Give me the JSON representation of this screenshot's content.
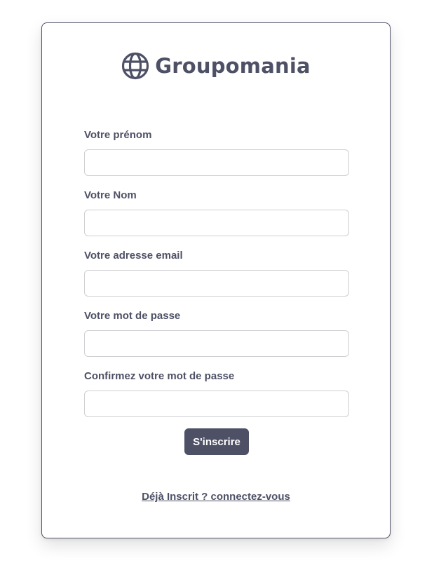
{
  "brand": {
    "name": "Groupomania",
    "icon": "globe-icon",
    "color": "#4e5166"
  },
  "form": {
    "fields": [
      {
        "label": "Votre prénom",
        "value": "",
        "type": "text"
      },
      {
        "label": "Votre Nom",
        "value": "",
        "type": "text"
      },
      {
        "label": "Votre adresse email",
        "value": "",
        "type": "email"
      },
      {
        "label": "Votre mot de passe",
        "value": "",
        "type": "password"
      },
      {
        "label": "Confirmez votre mot de passe",
        "value": "",
        "type": "password"
      }
    ],
    "submit_label": "S'inscrire"
  },
  "login_link": "Déjà Inscrit ? connectez-vous"
}
